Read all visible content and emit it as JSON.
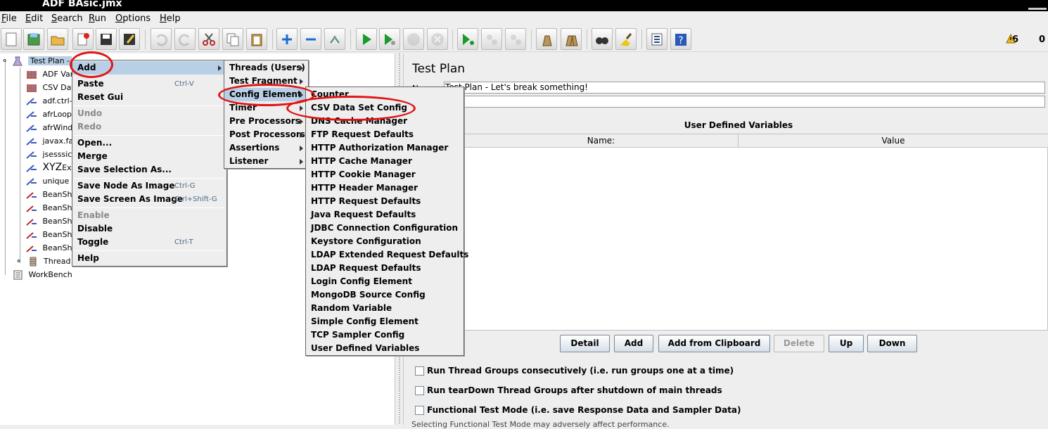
{
  "window": {
    "title": "ADF BAsic.jmx"
  },
  "menubar": [
    {
      "label": "File",
      "u": "F",
      "rest": "ile"
    },
    {
      "label": "Edit",
      "u": "E",
      "rest": "dit"
    },
    {
      "label": "Search",
      "u": "S",
      "rest": "earch"
    },
    {
      "label": "Run",
      "u": "R",
      "rest": "un"
    },
    {
      "label": "Options",
      "u": "O",
      "rest": "ptions"
    },
    {
      "label": "Help",
      "u": "H",
      "rest": "elp"
    }
  ],
  "toolbar": {
    "buttons": [
      "new-icon",
      "templates-icon",
      "open-icon",
      "close-icon",
      "save-icon",
      "save-as-icon",
      "undo-icon",
      "redo-icon",
      "cut-icon",
      "copy-icon",
      "paste-icon",
      "expand-icon",
      "collapse-icon",
      "toggle-icon",
      "start-icon",
      "start-no-pause-icon",
      "stop-icon",
      "shutdown-icon",
      "remote-start-icon",
      "remote-stop-icon",
      "remote-shutdown-icon",
      "clear-icon",
      "clear-all-icon",
      "search-icon",
      "reset-search-icon",
      "function-helper-icon",
      "help-icon"
    ],
    "warning_count": "6",
    "error_count": "0"
  },
  "tree": {
    "items": [
      {
        "label": "Test Plan - ",
        "icon": "test-plan-icon"
      },
      {
        "label": "ADF Var",
        "icon": "config-icon"
      },
      {
        "label": "CSV Dat",
        "icon": "config-icon"
      },
      {
        "label": "adf.ctrl-",
        "icon": "pre-processor-icon"
      },
      {
        "label": "afrLoop",
        "icon": "pre-processor-icon"
      },
      {
        "label": "afrWind",
        "icon": "pre-processor-icon"
      },
      {
        "label": "javax.fa",
        "icon": "pre-processor-icon"
      },
      {
        "label": "jsesssic",
        "icon": "pre-processor-icon"
      },
      {
        "label": "XYZ",
        "suffix": "Ex",
        "icon": "pre-processor-icon"
      },
      {
        "label": "unique",
        "icon": "pre-processor-icon"
      },
      {
        "label": "BeanShe",
        "icon": "beanshell-icon"
      },
      {
        "label": "BeanShe",
        "icon": "beanshell-icon"
      },
      {
        "label": "BeanShe",
        "icon": "beanshell-icon"
      },
      {
        "label": "BeanShe",
        "icon": "beanshell-icon"
      },
      {
        "label": "BeanShe",
        "icon": "beanshell-icon"
      },
      {
        "label": "Thread",
        "icon": "thread-group-icon"
      },
      {
        "label": "WorkBench",
        "icon": "workbench-icon"
      }
    ]
  },
  "context_menu": {
    "items": [
      {
        "label": "Add",
        "submenu": true
      },
      {
        "label": "Paste",
        "shortcut": "Ctrl-V"
      },
      {
        "label": "Reset Gui"
      },
      {
        "label": "Undo",
        "disabled": true
      },
      {
        "label": "Redo",
        "disabled": true
      },
      {
        "label": "Open..."
      },
      {
        "label": "Merge"
      },
      {
        "label": "Save Selection As..."
      },
      {
        "label": "Save Node As Image",
        "shortcut": "Ctrl-G"
      },
      {
        "label": "Save Screen As Image",
        "shortcut": "Ctrl+Shift-G"
      },
      {
        "label": "Enable",
        "disabled": true
      },
      {
        "label": "Disable"
      },
      {
        "label": "Toggle",
        "shortcut": "Ctrl-T"
      },
      {
        "label": "Help"
      }
    ]
  },
  "add_submenu": {
    "items": [
      "Threads (Users)",
      "Test Fragment",
      "Config Element",
      "Timer",
      "Pre Processors",
      "Post Processors",
      "Assertions",
      "Listener"
    ]
  },
  "config_submenu": {
    "items": [
      "Counter",
      "CSV Data Set Config",
      "DNS Cache Manager",
      "FTP Request Defaults",
      "HTTP Authorization Manager",
      "HTTP Cache Manager",
      "HTTP Cookie Manager",
      "HTTP Header Manager",
      "HTTP Request Defaults",
      "Java Request Defaults",
      "JDBC Connection Configuration",
      "Keystore Configuration",
      "LDAP Extended Request Defaults",
      "LDAP Request Defaults",
      "Login Config Element",
      "MongoDB Source Config",
      "Random Variable",
      "Simple Config Element",
      "TCP Sampler Config",
      "User Defined Variables"
    ]
  },
  "test_plan": {
    "title": "Test Plan",
    "name_label": "Name:",
    "name_value": "Test Plan - Let's break something!",
    "udv_title": "User Defined Variables",
    "columns": [
      "Name:",
      "Value"
    ],
    "buttons": [
      {
        "label": "Detail",
        "disabled": false
      },
      {
        "label": "Add",
        "disabled": false
      },
      {
        "label": "Add from Clipboard",
        "disabled": false
      },
      {
        "label": "Delete",
        "disabled": true
      },
      {
        "label": "Up",
        "disabled": false
      },
      {
        "label": "Down",
        "disabled": false
      }
    ],
    "checkboxes": [
      "Run Thread Groups consecutively (i.e. run groups one at a time)",
      "Run tearDown Thread Groups after shutdown of main threads",
      "Functional Test Mode (i.e. save Response Data and Sampler Data)"
    ],
    "cut_text": "Selecting Functional Test Mode may adversely affect performance."
  }
}
